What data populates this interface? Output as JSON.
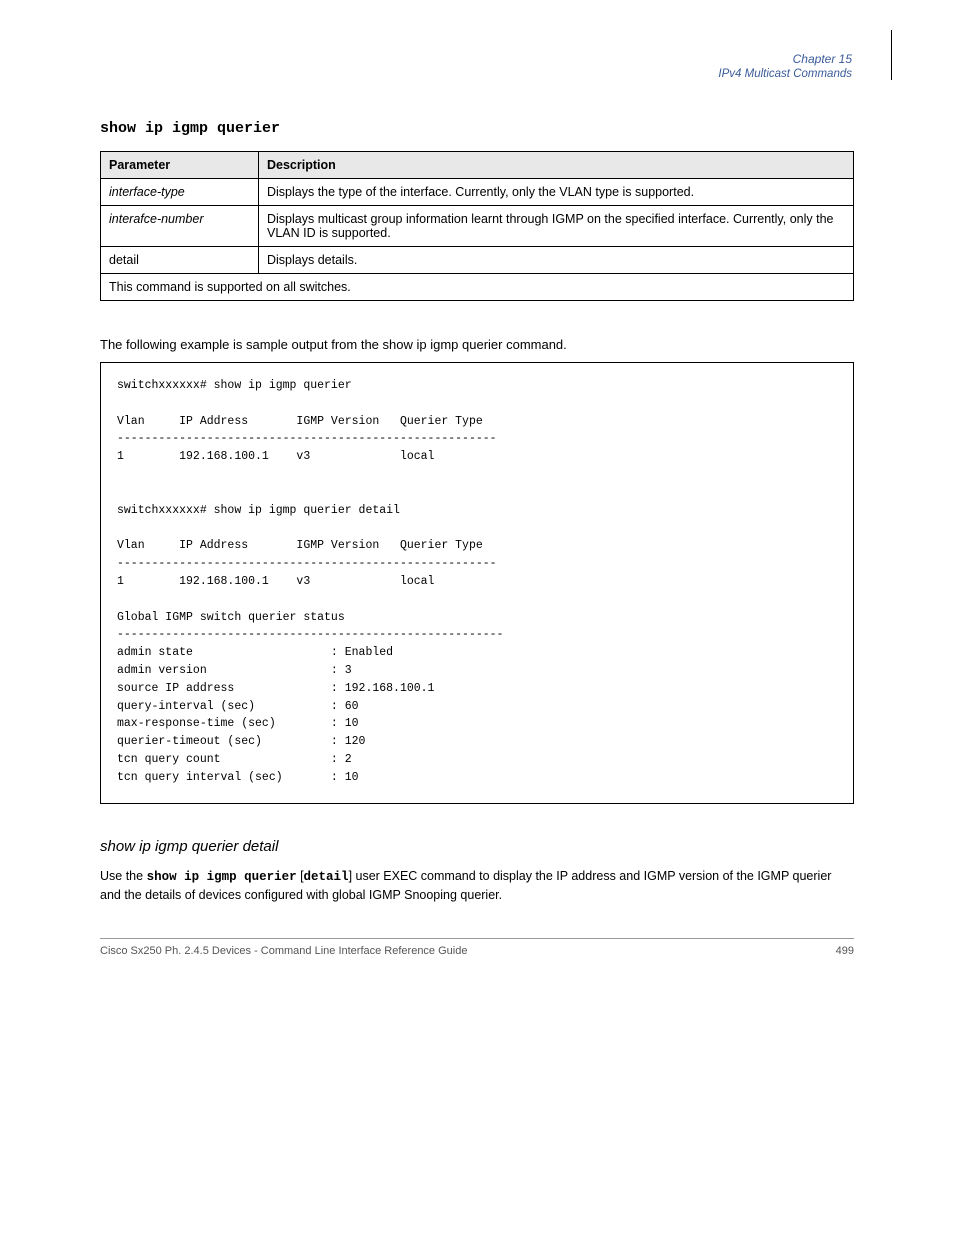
{
  "header": {
    "line1": "Chapter 15",
    "line2": "IPv4 Multicast Commands"
  },
  "command_title": "show ip igmp querier",
  "table": {
    "col_headers": [
      "Parameter",
      "Description"
    ],
    "rows": [
      {
        "p": "interface-type",
        "d": "Displays the type of the interface. Currently, only the VLAN type is supported."
      },
      {
        "p": "interafce-number ",
        "d": "Displays multicast group information learnt through IGMP on the specified interface. Currently, only the VLAN ID is supported."
      },
      {
        "p": "detail",
        "d": "Displays details."
      }
    ],
    "footer": "This command is supported on all switches."
  },
  "example": {
    "title": "The following example is sample output from the show ip igmp querier command.",
    "code": "switchxxxxxx# show ip igmp querier\n\nVlan     IP Address       IGMP Version   Querier Type\n-------------------------------------------------------\n1        192.168.100.1    v3             local\n\n\nswitchxxxxxx# show ip igmp querier detail\n\nVlan     IP Address       IGMP Version   Querier Type\n-------------------------------------------------------\n1        192.168.100.1    v3             local\n\nGlobal IGMP switch querier status\n--------------------------------------------------------\nadmin state                    : Enabled\nadmin version                  : 3\nsource IP address              : 192.168.100.1\nquery-interval (sec)           : 60\nmax-response-time (sec)        : 10\nquerier-timeout (sec)          : 120\ntcn query count                : 2\ntcn query interval (sec)       : 10"
  },
  "section": {
    "title": "show ip igmp querier detail",
    "intro_prefix": "Use the ",
    "cmd": "show ip igmp querier",
    "intro_mid": " [",
    "arg": "detail",
    "intro_suffix": "] user EXEC command to display the IP address and IGMP version of the IGMP querier and the details of devices configured with global IGMP Snooping querier."
  },
  "footer": {
    "doc": "Cisco Sx250 Ph. 2.4.5 Devices - Command Line Interface Reference Guide",
    "page": "499"
  }
}
